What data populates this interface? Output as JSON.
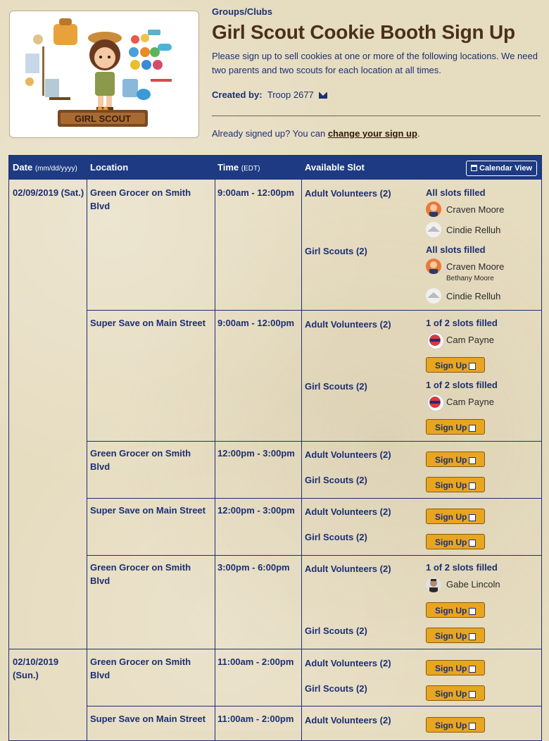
{
  "header": {
    "category": "Groups/Clubs",
    "title": "Girl Scout Cookie Booth Sign Up",
    "description": "Please sign up to sell cookies at one or more of the following locations. We need two parents and two scouts for each location at all times.",
    "created_label": "Created by:",
    "creator": "Troop 2677",
    "already_text": "Already signed up? You can ",
    "change_link": "change your sign up",
    "period": "."
  },
  "image": {
    "banner_text": "GIRL SCOUT"
  },
  "table": {
    "headers": {
      "date": "Date",
      "date_format": "(mm/dd/yyyy)",
      "location": "Location",
      "time": "Time",
      "tz": "(EDT)",
      "slot": "Available Slot",
      "calendar": "Calendar View"
    },
    "dates": {
      "d1": "02/09/2019 (Sat.)",
      "d2": "02/10/2019 (Sun.)"
    },
    "rows": [
      {
        "location": "Green Grocer on Smith Blvd",
        "time": "9:00am - 12:00pm"
      },
      {
        "location": "Super Save on Main Street",
        "time": "9:00am - 12:00pm"
      },
      {
        "location": "Green Grocer on Smith Blvd",
        "time": "12:00pm - 3:00pm"
      },
      {
        "location": "Super Save on Main Street",
        "time": "12:00pm - 3:00pm"
      },
      {
        "location": "Green Grocer on Smith Blvd",
        "time": "3:00pm - 6:00pm"
      },
      {
        "location": "Green Grocer on Smith Blvd",
        "time": "11:00am - 2:00pm"
      },
      {
        "location": "Super Save on Main Street",
        "time": "11:00am - 2:00pm"
      }
    ],
    "slots": {
      "adult": "Adult Volunteers (2)",
      "scouts": "Girl Scouts (2)"
    },
    "status": {
      "all_filled": "All slots filled",
      "one_of_two": "1 of 2 slots filled"
    },
    "people": {
      "craven": "Craven Moore",
      "cindie": "Cindie Relluh",
      "bethany": "Bethany Moore",
      "cam": "Cam Payne",
      "gabe": "Gabe Lincoln"
    },
    "signup_label": "Sign Up"
  },
  "colors": {
    "accent": "#1d3a82",
    "button": "#e8a520",
    "title": "#4a3019"
  }
}
